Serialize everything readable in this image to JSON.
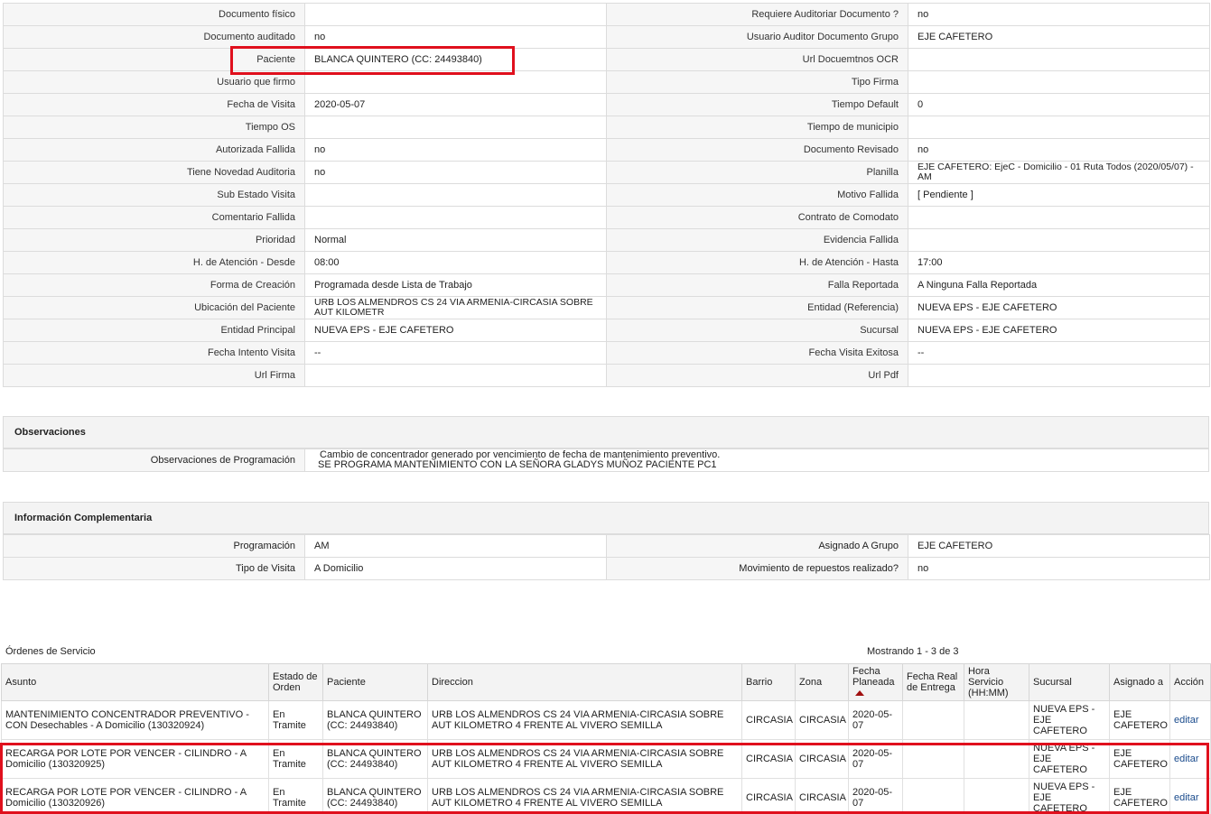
{
  "details": [
    {
      "l1": "Documento físico",
      "v1": "",
      "l2": "Requiere Auditoriar Documento ?",
      "v2": "no"
    },
    {
      "l1": "Documento auditado",
      "v1": "no",
      "l2": "Usuario Auditor Documento Grupo",
      "v2": "EJE CAFETERO"
    },
    {
      "l1": "Paciente",
      "v1": "BLANCA QUINTERO (CC: 24493840)",
      "l2": "Url Docuemtnos OCR",
      "v2": ""
    },
    {
      "l1": "Usuario que firmo",
      "v1": "",
      "l2": "Tipo Firma",
      "v2": ""
    },
    {
      "l1": "Fecha de Visita",
      "v1": "2020-05-07",
      "l2": "Tiempo Default",
      "v2": "0"
    },
    {
      "l1": "Tiempo OS",
      "v1": "",
      "l2": "Tiempo de municipio",
      "v2": ""
    },
    {
      "l1": "Autorizada Fallida",
      "v1": "no",
      "l2": "Documento Revisado",
      "v2": "no"
    },
    {
      "l1": "Tiene Novedad Auditoria",
      "v1": "no",
      "l2": "Planilla",
      "v2": "EJE CAFETERO: EjeC - Domicilio - 01 Ruta Todos (2020/05/07) - AM"
    },
    {
      "l1": "Sub Estado Visita",
      "v1": "",
      "l2": "Motivo Fallida",
      "v2": "[ Pendiente ]"
    },
    {
      "l1": "Comentario Fallida",
      "v1": "",
      "l2": "Contrato de Comodato",
      "v2": ""
    },
    {
      "l1": "Prioridad",
      "v1": "Normal",
      "l2": "Evidencia Fallida",
      "v2": ""
    },
    {
      "l1": "H. de Atención - Desde",
      "v1": "08:00",
      "l2": "H. de Atención - Hasta",
      "v2": "17:00"
    },
    {
      "l1": "Forma de Creación",
      "v1": "Programada desde Lista de Trabajo",
      "l2": "Falla Reportada",
      "v2": "A Ninguna Falla Reportada"
    },
    {
      "l1": "Ubicación del Paciente",
      "v1": "URB LOS ALMENDROS CS 24 VIA ARMENIA-CIRCASIA SOBRE AUT KILOMETR",
      "l2": "Entidad (Referencia)",
      "v2": "NUEVA EPS - EJE CAFETERO"
    },
    {
      "l1": "Entidad Principal",
      "v1": "NUEVA EPS - EJE CAFETERO",
      "l2": "Sucursal",
      "v2": "NUEVA EPS - EJE CAFETERO"
    },
    {
      "l1": "Fecha Intento Visita",
      "v1": "--",
      "l2": "Fecha Visita Exitosa",
      "v2": "--"
    },
    {
      "l1": "Url Firma",
      "v1": "",
      "l2": "Url Pdf",
      "v2": ""
    }
  ],
  "observaciones": {
    "title": "Observaciones",
    "label": "Observaciones de Programación",
    "line1": "Cambio de concentrador generado por vencimiento de fecha de mantenimiento preventivo.",
    "line2": "SE PROGRAMA MANTENIMIENTO CON LA SEÑORA GLADYS MUÑOZ PACIENTE PC1"
  },
  "complementaria": {
    "title": "Información Complementaria",
    "rows": [
      {
        "l1": "Programación",
        "v1": "AM",
        "l2": "Asignado A Grupo",
        "v2": "EJE CAFETERO"
      },
      {
        "l1": "Tipo de Visita",
        "v1": "A Domicilio",
        "l2": "Movimiento de repuestos realizado?",
        "v2": "no"
      }
    ]
  },
  "orders": {
    "title": "Órdenes de Servicio",
    "count_text": "Mostrando 1 - 3 de 3",
    "headers": [
      "Asunto",
      "Estado de Orden",
      "Paciente",
      "Direccion",
      "Barrio",
      "Zona",
      "Fecha Planeada",
      "Fecha Real de Entrega",
      "Hora Servicio (HH:MM)",
      "Sucursal",
      "Asignado a",
      "Acción"
    ],
    "sorted_column": "Fecha Planeada",
    "rows": [
      {
        "asunto": "MANTENIMIENTO CONCENTRADOR PREVENTIVO - CON Desechables - A Domicilio (130320924)",
        "estado": "En Tramite",
        "paciente": "BLANCA QUINTERO (CC: 24493840)",
        "direccion": "URB LOS ALMENDROS CS 24 VIA ARMENIA-CIRCASIA SOBRE AUT KILOMETRO 4 FRENTE AL VIVERO SEMILLA",
        "barrio": "CIRCASIA",
        "zona": "CIRCASIA",
        "fecha_planeada": "2020-05-07",
        "fecha_real": "",
        "hora": "",
        "sucursal": "NUEVA EPS - EJE CAFETERO",
        "asignado": "EJE CAFETERO",
        "accion": "editar"
      },
      {
        "asunto": "RECARGA POR LOTE POR VENCER - CILINDRO - A Domicilio (130320925)",
        "estado": "En Tramite",
        "paciente": "BLANCA QUINTERO (CC: 24493840)",
        "direccion": "URB LOS ALMENDROS CS 24 VIA ARMENIA-CIRCASIA SOBRE AUT KILOMETRO 4 FRENTE AL VIVERO SEMILLA",
        "barrio": "CIRCASIA",
        "zona": "CIRCASIA",
        "fecha_planeada": "2020-05-07",
        "fecha_real": "",
        "hora": "",
        "sucursal": "NUEVA EPS - EJE CAFETERO",
        "asignado": "EJE CAFETERO",
        "accion": "editar"
      },
      {
        "asunto": "RECARGA POR LOTE POR VENCER - CILINDRO - A Domicilio (130320926)",
        "estado": "En Tramite",
        "paciente": "BLANCA QUINTERO (CC: 24493840)",
        "direccion": "URB LOS ALMENDROS CS 24 VIA ARMENIA-CIRCASIA SOBRE AUT KILOMETRO 4 FRENTE AL VIVERO SEMILLA",
        "barrio": "CIRCASIA",
        "zona": "CIRCASIA",
        "fecha_planeada": "2020-05-07",
        "fecha_real": "",
        "hora": "",
        "sucursal": "NUEVA EPS - EJE CAFETERO",
        "asignado": "EJE CAFETERO",
        "accion": "editar"
      }
    ]
  },
  "colors": {
    "highlight": "#e0101d",
    "link": "#1a4b8c",
    "label_bg": "#f6f6f6",
    "border": "#dcdcdc"
  }
}
